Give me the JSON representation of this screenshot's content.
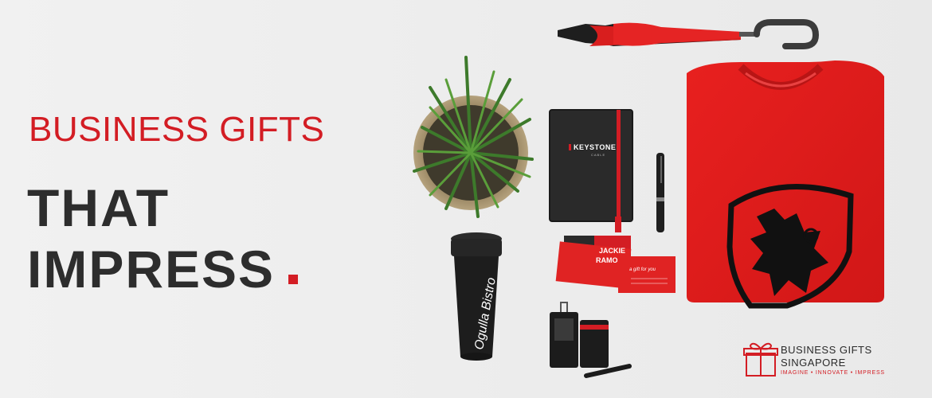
{
  "headline": {
    "line1": "BUSINESS GIFTS",
    "line2": "THAT",
    "line3": "IMPRESS"
  },
  "products": {
    "notebook_brand": "KEYSTONE",
    "notebook_sub": "CABLE",
    "card_name_1": "JACKIE",
    "card_name_2": "RAMOS",
    "gift_card_text": "a gift for you",
    "tumbler_text": "Ogulla Bistro"
  },
  "logo": {
    "line1": "BUSINESS GIFTS",
    "line2": "SINGAPORE",
    "tagline": "IMAGINE • INNOVATE • IMPRESS"
  },
  "colors": {
    "accent": "#d31d24",
    "text_dark": "#2d2d2d",
    "background": "#efefef"
  }
}
